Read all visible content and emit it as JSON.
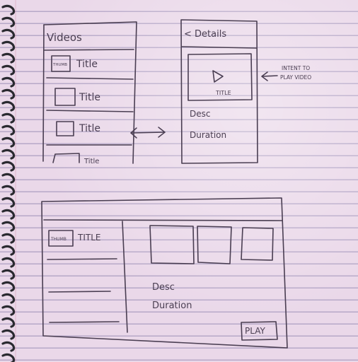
{
  "phone_list": {
    "header": "Videos",
    "thumb_label": "THUMB",
    "items": [
      "Title",
      "Title",
      "Title"
    ],
    "partial_item": "Title"
  },
  "phone_detail": {
    "back_label": "< Details",
    "video_title": "TITLE",
    "desc": "Desc",
    "duration": "Duration"
  },
  "annotation": {
    "line1": "INTENT TO",
    "line2": "PLAY VIDEO"
  },
  "tablet": {
    "thumb_label": "THUMB",
    "item_title": "TITLE",
    "desc": "Desc",
    "duration": "Duration",
    "play_label": "PLAY"
  },
  "colors": {
    "ink": "#4a3e52",
    "paper": "#ead8e9"
  }
}
